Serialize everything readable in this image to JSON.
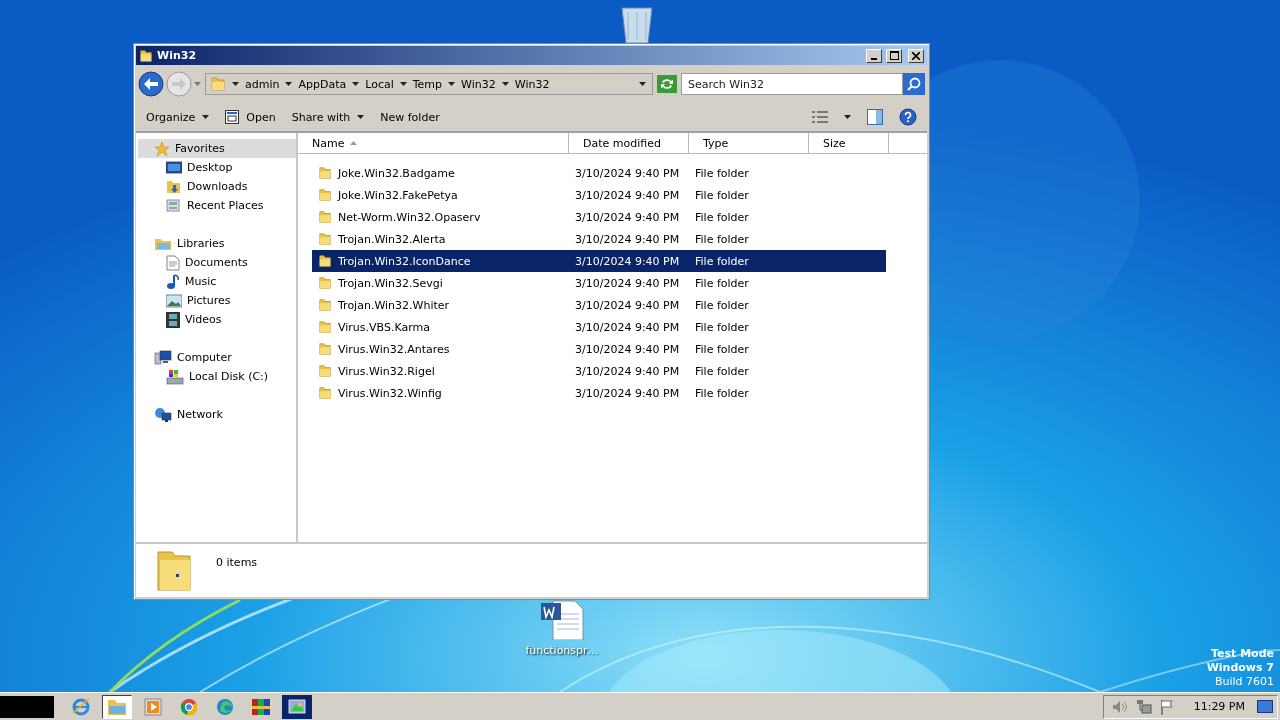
{
  "desktop": {
    "icons": [
      {
        "label": "functionspr…"
      }
    ],
    "watermark": [
      "Test Mode",
      "Windows 7",
      "Build 7601"
    ]
  },
  "window": {
    "title": "Win32"
  },
  "address": {
    "segments": [
      "admin",
      "AppData",
      "Local",
      "Temp",
      "Win32",
      "Win32"
    ]
  },
  "search": {
    "placeholder": "Search Win32"
  },
  "toolbar": {
    "items": [
      {
        "label": "Organize",
        "kind": "menu"
      },
      {
        "label": "Open",
        "kind": "icon"
      },
      {
        "label": "Share with",
        "kind": "menu"
      },
      {
        "label": "New folder",
        "kind": "plain"
      }
    ]
  },
  "sidebar": {
    "groups": [
      {
        "label": "Favorites",
        "selected": true,
        "children": [
          {
            "label": "Desktop",
            "selected": false
          },
          {
            "label": "Downloads",
            "selected": false
          },
          {
            "label": "Recent Places",
            "selected": false
          }
        ]
      },
      {
        "label": "Libraries",
        "selected": false,
        "children": [
          {
            "label": "Documents",
            "selected": false
          },
          {
            "label": "Music",
            "selected": false
          },
          {
            "label": "Pictures",
            "selected": false
          },
          {
            "label": "Videos",
            "selected": false
          }
        ]
      },
      {
        "label": "Computer",
        "selected": false,
        "children": [
          {
            "label": "Local Disk (C:)",
            "selected": false
          }
        ]
      },
      {
        "label": "Network",
        "selected": false
      }
    ]
  },
  "table": {
    "columns": [
      {
        "label": "Name",
        "sorted": true
      },
      {
        "label": "Date modified",
        "sorted": false
      },
      {
        "label": "Type",
        "sorted": false
      },
      {
        "label": "Size",
        "sorted": false
      }
    ],
    "rows": [
      {
        "name": "Joke.Win32.Badgame",
        "date": "3/10/2024 9:40 PM",
        "type": "File folder",
        "selected": false
      },
      {
        "name": "Joke.Win32.FakePetya",
        "date": "3/10/2024 9:40 PM",
        "type": "File folder",
        "selected": false
      },
      {
        "name": "Net-Worm.Win32.Opaserv",
        "date": "3/10/2024 9:40 PM",
        "type": "File folder",
        "selected": false
      },
      {
        "name": "Trojan.Win32.Alerta",
        "date": "3/10/2024 9:40 PM",
        "type": "File folder",
        "selected": false
      },
      {
        "name": "Trojan.Win32.IconDance",
        "date": "3/10/2024 9:40 PM",
        "type": "File folder",
        "selected": true
      },
      {
        "name": "Trojan.Win32.Sevgi",
        "date": "3/10/2024 9:40 PM",
        "type": "File folder",
        "selected": false
      },
      {
        "name": "Trojan.Win32.Whiter",
        "date": "3/10/2024 9:40 PM",
        "type": "File folder",
        "selected": false
      },
      {
        "name": "Virus.VBS.Karma",
        "date": "3/10/2024 9:40 PM",
        "type": "File folder",
        "selected": false
      },
      {
        "name": "Virus.Win32.Antares",
        "date": "3/10/2024 9:40 PM",
        "type": "File folder",
        "selected": false
      },
      {
        "name": "Virus.Win32.Rigel",
        "date": "3/10/2024 9:40 PM",
        "type": "File folder",
        "selected": false
      },
      {
        "name": "Virus.Win32.Winfig",
        "date": "3/10/2024 9:40 PM",
        "type": "File folder",
        "selected": false
      }
    ]
  },
  "details": {
    "text": "0 items"
  },
  "taskbar": {
    "buttons": [
      {
        "selected": false
      },
      {
        "selected": true
      },
      {
        "selected": false
      },
      {
        "selected": false
      },
      {
        "selected": false
      },
      {
        "selected": false
      },
      {
        "selected": false
      }
    ],
    "clock": "11:29 PM"
  }
}
